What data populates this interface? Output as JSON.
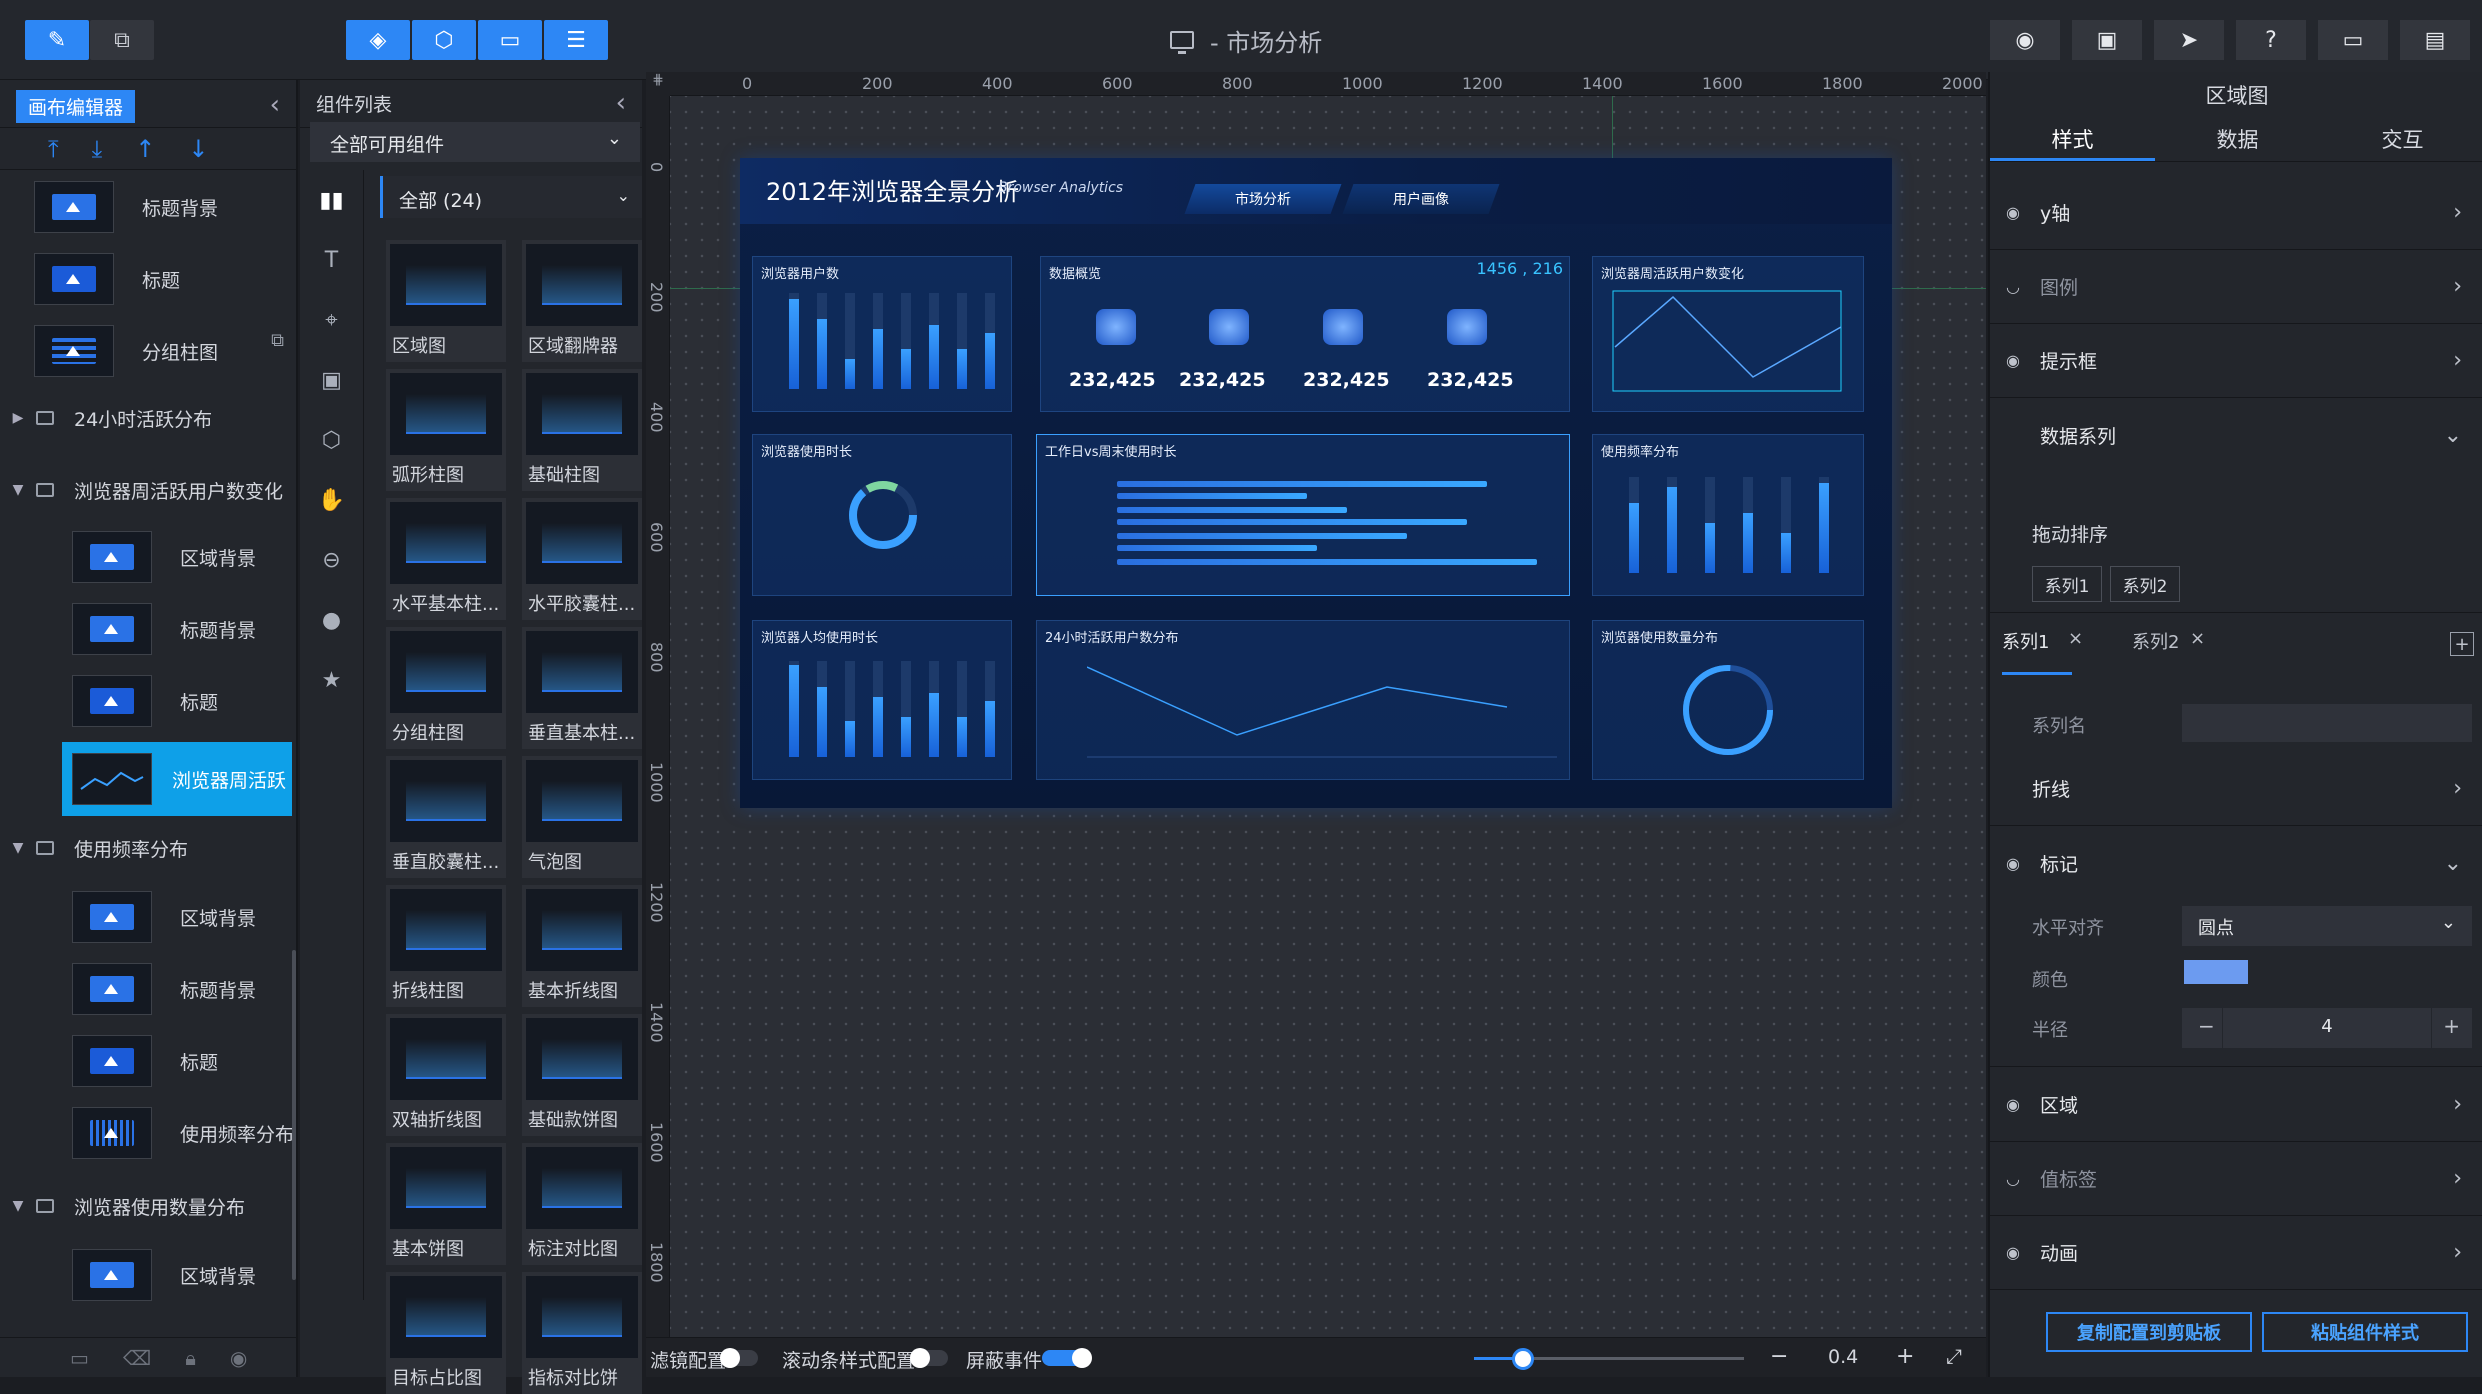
{
  "window": {
    "title": " - 市场分析"
  },
  "toolbar": {
    "left_tabs": [
      "edit-icon",
      "layout-icon"
    ],
    "center_icons": [
      "layers-icon",
      "cube-icon",
      "panel-icon",
      "database-icon"
    ],
    "right_icons": [
      "eye-icon",
      "record-icon",
      "send-icon",
      "help-icon",
      "preview-icon",
      "save-icon"
    ]
  },
  "layers_panel": {
    "header": "画布编辑器",
    "items": [
      {
        "type": "layer",
        "name": "标题背景"
      },
      {
        "type": "layer",
        "name": "标题"
      },
      {
        "type": "layer",
        "name": "分组柱图"
      },
      {
        "type": "group",
        "name": "24小时活跃分布",
        "expanded": false
      },
      {
        "type": "group",
        "name": "浏览器周活跃用户数变化",
        "expanded": true
      },
      {
        "type": "layer",
        "name": "区域背景"
      },
      {
        "type": "layer",
        "name": "标题背景"
      },
      {
        "type": "layer",
        "name": "标题"
      },
      {
        "type": "layer",
        "name": "浏览器周活跃",
        "selected": true
      },
      {
        "type": "group",
        "name": "使用频率分布",
        "expanded": true
      },
      {
        "type": "layer",
        "name": "区域背景"
      },
      {
        "type": "layer",
        "name": "标题背景"
      },
      {
        "type": "layer",
        "name": "标题"
      },
      {
        "type": "layer",
        "name": "使用频率分布"
      },
      {
        "type": "group",
        "name": "浏览器使用数量分布",
        "expanded": true
      },
      {
        "type": "layer",
        "name": "区域背景"
      }
    ]
  },
  "components_panel": {
    "header": "组件列表",
    "filter": "全部可用组件",
    "category": "全部 (24)",
    "items": [
      "区域图",
      "区域翻牌器",
      "弧形柱图",
      "基础柱图",
      "水平基本柱...",
      "水平胶囊柱...",
      "分组柱图",
      "垂直基本柱...",
      "垂直胶囊柱...",
      "气泡图",
      "折线柱图",
      "基本折线图",
      "双轴折线图",
      "基础款饼图",
      "基本饼图",
      "标注对比图",
      "目标占比图",
      "指标对比饼"
    ]
  },
  "ruler": {
    "h": [
      "0",
      "200",
      "400",
      "600",
      "800",
      "1000",
      "1200",
      "1400",
      "1600",
      "1800",
      "2000"
    ],
    "v": [
      "0",
      "200",
      "400",
      "600",
      "800",
      "1000",
      "1200",
      "1400",
      "1600",
      "1800"
    ]
  },
  "dashboard": {
    "title": "2012年浏览器全景分析",
    "subtitle": "Browser Analytics",
    "tabs": [
      "市场分析",
      "用户画像"
    ],
    "coord": "1456 , 216",
    "panels": {
      "users": "浏览器用户数",
      "overview": "数据概览",
      "weekly": "浏览器周活跃用户数变化",
      "duration": "浏览器使用时长",
      "workday": "工作日vs周末使用时长",
      "frequency": "使用频率分布",
      "per_user": "浏览器人均使用时长",
      "hourly": "24小时活跃用户数分布",
      "count": "浏览器使用数量分布"
    },
    "stats": [
      "232,425",
      "232,425",
      "232,425",
      "232,425"
    ]
  },
  "properties_panel": {
    "title": "区域图",
    "tabs": [
      "样式",
      "数据",
      "交互"
    ],
    "sections": [
      "y轴",
      "图例",
      "提示框",
      "数据系列"
    ],
    "drag_sort": "拖动排序",
    "series_chips": [
      "系列1",
      "系列2"
    ],
    "series_tabs": [
      "系列1",
      "系列2"
    ],
    "series_name_label": "系列名",
    "line_label": "折线",
    "marker_label": "标记",
    "align_label": "水平对齐",
    "align_value": "圆点",
    "color_label": "颜色",
    "color_value": "#6c9bf0",
    "radius_label": "半径",
    "radius_value": "4",
    "more_sections": [
      "区域",
      "值标签",
      "动画"
    ],
    "copy_button": "复制配置到剪贴板",
    "paste_button": "粘贴组件样式"
  },
  "bottom_bar": {
    "filter": "滤镜配置",
    "scroll": "滚动条样式配置",
    "block": "屏蔽事件",
    "zoom": "0.4"
  }
}
